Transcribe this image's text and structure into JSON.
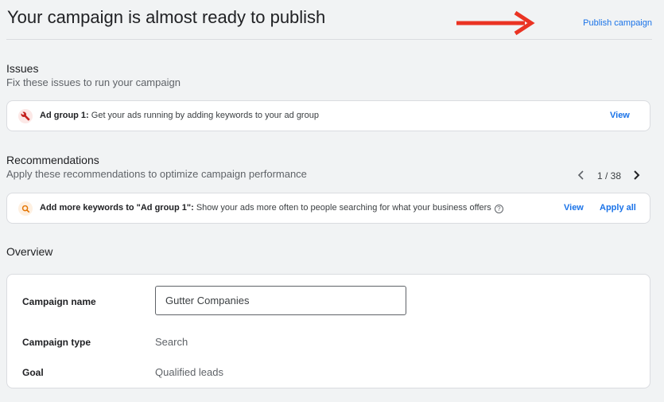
{
  "header": {
    "title": "Your campaign is almost ready to publish",
    "publish_label": "Publish campaign",
    "annotation_arrow_color": "#ea3323"
  },
  "issues": {
    "title": "Issues",
    "subtitle": "Fix these issues to run your campaign",
    "items": [
      {
        "icon": "wrench-icon",
        "bold": "Ad group 1:",
        "text": " Get your ads running by adding keywords to your ad group",
        "action": "View"
      }
    ]
  },
  "recommendations": {
    "title": "Recommendations",
    "subtitle": "Apply these recommendations to optimize campaign performance",
    "pager": "1 / 38",
    "items": [
      {
        "icon": "search-icon",
        "bold": "Add more keywords to \"Ad group 1\":",
        "text": " Show your ads more often to people searching for what your business offers",
        "view_label": "View",
        "apply_label": "Apply all"
      }
    ]
  },
  "overview": {
    "title": "Overview",
    "campaign_name_label": "Campaign name",
    "campaign_name_value": "Gutter Companies",
    "campaign_type_label": "Campaign type",
    "campaign_type_value": "Search",
    "goal_label": "Goal",
    "goal_value": "Qualified leads"
  },
  "colors": {
    "background": "#f1f3f4",
    "link": "#1a73e8",
    "issue_icon": "#c5221f",
    "recommendation_icon": "#e37400"
  }
}
